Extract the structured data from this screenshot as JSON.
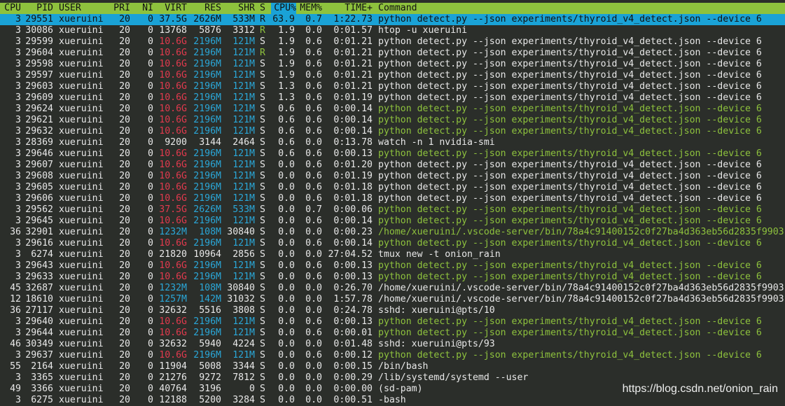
{
  "header": {
    "columns": [
      "CPU",
      "PID",
      "USER",
      "PRI",
      "NI",
      "VIRT",
      "RES",
      "SHR",
      "S",
      "CPU%",
      "MEM%",
      "TIME+",
      "Command"
    ],
    "sorted_column": "CPU%"
  },
  "colors": {
    "header_bg": "#8ec23d",
    "selected_bg": "#1aa2d6",
    "memory_gb": "#e23a4e",
    "memory_mb": "#2aa7d8",
    "thread_cmd": "#8ec23d",
    "running_state": "#8ec23d"
  },
  "processes": [
    {
      "cpu": "3",
      "pid": "29551",
      "user": "xueruini",
      "pri": "20",
      "ni": "0",
      "virt": "37.5G",
      "res": "2626M",
      "shr": "533M",
      "s": "R",
      "cpu_pct": "63.9",
      "mem_pct": "0.7",
      "time": "1:22.73",
      "command": "python detect.py --json experiments/thyroid_v4_detect.json --device 6",
      "selected": true,
      "thread": false
    },
    {
      "cpu": "3",
      "pid": "30086",
      "user": "xueruini",
      "pri": "20",
      "ni": "0",
      "virt": "13768",
      "res": "5876",
      "shr": "3312",
      "s": "R",
      "cpu_pct": "1.9",
      "mem_pct": "0.0",
      "time": "0:01.57",
      "command": "htop -u xueruini",
      "thread": false
    },
    {
      "cpu": "3",
      "pid": "29599",
      "user": "xueruini",
      "pri": "20",
      "ni": "0",
      "virt": "10.6G",
      "res": "2196M",
      "shr": "121M",
      "s": "S",
      "cpu_pct": "1.9",
      "mem_pct": "0.6",
      "time": "0:01.21",
      "command": "python detect.py --json experiments/thyroid_v4_detect.json --device 6",
      "thread": false
    },
    {
      "cpu": "3",
      "pid": "29604",
      "user": "xueruini",
      "pri": "20",
      "ni": "0",
      "virt": "10.6G",
      "res": "2196M",
      "shr": "121M",
      "s": "R",
      "cpu_pct": "1.9",
      "mem_pct": "0.6",
      "time": "0:01.21",
      "command": "python detect.py --json experiments/thyroid_v4_detect.json --device 6",
      "thread": false
    },
    {
      "cpu": "3",
      "pid": "29598",
      "user": "xueruini",
      "pri": "20",
      "ni": "0",
      "virt": "10.6G",
      "res": "2196M",
      "shr": "121M",
      "s": "S",
      "cpu_pct": "1.9",
      "mem_pct": "0.6",
      "time": "0:01.21",
      "command": "python detect.py --json experiments/thyroid_v4_detect.json --device 6",
      "thread": false
    },
    {
      "cpu": "3",
      "pid": "29597",
      "user": "xueruini",
      "pri": "20",
      "ni": "0",
      "virt": "10.6G",
      "res": "2196M",
      "shr": "121M",
      "s": "S",
      "cpu_pct": "1.9",
      "mem_pct": "0.6",
      "time": "0:01.21",
      "command": "python detect.py --json experiments/thyroid_v4_detect.json --device 6",
      "thread": false
    },
    {
      "cpu": "3",
      "pid": "29603",
      "user": "xueruini",
      "pri": "20",
      "ni": "0",
      "virt": "10.6G",
      "res": "2196M",
      "shr": "121M",
      "s": "S",
      "cpu_pct": "1.3",
      "mem_pct": "0.6",
      "time": "0:01.21",
      "command": "python detect.py --json experiments/thyroid_v4_detect.json --device 6",
      "thread": false
    },
    {
      "cpu": "3",
      "pid": "29609",
      "user": "xueruini",
      "pri": "20",
      "ni": "0",
      "virt": "10.6G",
      "res": "2196M",
      "shr": "121M",
      "s": "S",
      "cpu_pct": "1.3",
      "mem_pct": "0.6",
      "time": "0:01.19",
      "command": "python detect.py --json experiments/thyroid_v4_detect.json --device 6",
      "thread": false
    },
    {
      "cpu": "3",
      "pid": "29624",
      "user": "xueruini",
      "pri": "20",
      "ni": "0",
      "virt": "10.6G",
      "res": "2196M",
      "shr": "121M",
      "s": "S",
      "cpu_pct": "0.6",
      "mem_pct": "0.6",
      "time": "0:00.14",
      "command": "python detect.py --json experiments/thyroid_v4_detect.json --device 6",
      "thread": true
    },
    {
      "cpu": "3",
      "pid": "29621",
      "user": "xueruini",
      "pri": "20",
      "ni": "0",
      "virt": "10.6G",
      "res": "2196M",
      "shr": "121M",
      "s": "S",
      "cpu_pct": "0.6",
      "mem_pct": "0.6",
      "time": "0:00.14",
      "command": "python detect.py --json experiments/thyroid_v4_detect.json --device 6",
      "thread": true
    },
    {
      "cpu": "3",
      "pid": "29632",
      "user": "xueruini",
      "pri": "20",
      "ni": "0",
      "virt": "10.6G",
      "res": "2196M",
      "shr": "121M",
      "s": "S",
      "cpu_pct": "0.6",
      "mem_pct": "0.6",
      "time": "0:00.14",
      "command": "python detect.py --json experiments/thyroid_v4_detect.json --device 6",
      "thread": true
    },
    {
      "cpu": "3",
      "pid": "28369",
      "user": "xueruini",
      "pri": "20",
      "ni": "0",
      "virt": "9200",
      "res": "3144",
      "shr": "2464",
      "s": "S",
      "cpu_pct": "0.6",
      "mem_pct": "0.0",
      "time": "0:13.78",
      "command": "watch -n 1 nvidia-smi",
      "thread": false
    },
    {
      "cpu": "3",
      "pid": "29646",
      "user": "xueruini",
      "pri": "20",
      "ni": "0",
      "virt": "10.6G",
      "res": "2196M",
      "shr": "121M",
      "s": "S",
      "cpu_pct": "0.6",
      "mem_pct": "0.6",
      "time": "0:00.13",
      "command": "python detect.py --json experiments/thyroid_v4_detect.json --device 6",
      "thread": true
    },
    {
      "cpu": "3",
      "pid": "29607",
      "user": "xueruini",
      "pri": "20",
      "ni": "0",
      "virt": "10.6G",
      "res": "2196M",
      "shr": "121M",
      "s": "S",
      "cpu_pct": "0.0",
      "mem_pct": "0.6",
      "time": "0:01.20",
      "command": "python detect.py --json experiments/thyroid_v4_detect.json --device 6",
      "thread": false
    },
    {
      "cpu": "3",
      "pid": "29608",
      "user": "xueruini",
      "pri": "20",
      "ni": "0",
      "virt": "10.6G",
      "res": "2196M",
      "shr": "121M",
      "s": "S",
      "cpu_pct": "0.0",
      "mem_pct": "0.6",
      "time": "0:01.19",
      "command": "python detect.py --json experiments/thyroid_v4_detect.json --device 6",
      "thread": false
    },
    {
      "cpu": "3",
      "pid": "29605",
      "user": "xueruini",
      "pri": "20",
      "ni": "0",
      "virt": "10.6G",
      "res": "2196M",
      "shr": "121M",
      "s": "S",
      "cpu_pct": "0.0",
      "mem_pct": "0.6",
      "time": "0:01.18",
      "command": "python detect.py --json experiments/thyroid_v4_detect.json --device 6",
      "thread": false
    },
    {
      "cpu": "3",
      "pid": "29606",
      "user": "xueruini",
      "pri": "20",
      "ni": "0",
      "virt": "10.6G",
      "res": "2196M",
      "shr": "121M",
      "s": "S",
      "cpu_pct": "0.0",
      "mem_pct": "0.6",
      "time": "0:01.18",
      "command": "python detect.py --json experiments/thyroid_v4_detect.json --device 6",
      "thread": false
    },
    {
      "cpu": "3",
      "pid": "29562",
      "user": "xueruini",
      "pri": "20",
      "ni": "0",
      "virt": "37.5G",
      "res": "2626M",
      "shr": "533M",
      "s": "S",
      "cpu_pct": "0.0",
      "mem_pct": "0.7",
      "time": "0:00.06",
      "command": "python detect.py --json experiments/thyroid_v4_detect.json --device 6",
      "thread": true
    },
    {
      "cpu": "3",
      "pid": "29645",
      "user": "xueruini",
      "pri": "20",
      "ni": "0",
      "virt": "10.6G",
      "res": "2196M",
      "shr": "121M",
      "s": "S",
      "cpu_pct": "0.0",
      "mem_pct": "0.6",
      "time": "0:00.14",
      "command": "python detect.py --json experiments/thyroid_v4_detect.json --device 6",
      "thread": true
    },
    {
      "cpu": "36",
      "pid": "32901",
      "user": "xueruini",
      "pri": "20",
      "ni": "0",
      "virt": "1232M",
      "res": "108M",
      "shr": "30840",
      "s": "S",
      "cpu_pct": "0.0",
      "mem_pct": "0.0",
      "time": "0:00.23",
      "command": "/home/xueruini/.vscode-server/bin/78a4c91400152c0f27ba4d363eb56d2835f9903",
      "thread": true
    },
    {
      "cpu": "3",
      "pid": "29616",
      "user": "xueruini",
      "pri": "20",
      "ni": "0",
      "virt": "10.6G",
      "res": "2196M",
      "shr": "121M",
      "s": "S",
      "cpu_pct": "0.0",
      "mem_pct": "0.6",
      "time": "0:00.14",
      "command": "python detect.py --json experiments/thyroid_v4_detect.json --device 6",
      "thread": true
    },
    {
      "cpu": "3",
      "pid": "6274",
      "user": "xueruini",
      "pri": "20",
      "ni": "0",
      "virt": "21820",
      "res": "10964",
      "shr": "2856",
      "s": "S",
      "cpu_pct": "0.0",
      "mem_pct": "0.0",
      "time": "27:04.52",
      "command": "tmux new -t onion_rain",
      "thread": false
    },
    {
      "cpu": "3",
      "pid": "29643",
      "user": "xueruini",
      "pri": "20",
      "ni": "0",
      "virt": "10.6G",
      "res": "2196M",
      "shr": "121M",
      "s": "S",
      "cpu_pct": "0.0",
      "mem_pct": "0.6",
      "time": "0:00.13",
      "command": "python detect.py --json experiments/thyroid_v4_detect.json --device 6",
      "thread": true
    },
    {
      "cpu": "3",
      "pid": "29633",
      "user": "xueruini",
      "pri": "20",
      "ni": "0",
      "virt": "10.6G",
      "res": "2196M",
      "shr": "121M",
      "s": "S",
      "cpu_pct": "0.0",
      "mem_pct": "0.6",
      "time": "0:00.13",
      "command": "python detect.py --json experiments/thyroid_v4_detect.json --device 6",
      "thread": true
    },
    {
      "cpu": "45",
      "pid": "32687",
      "user": "xueruini",
      "pri": "20",
      "ni": "0",
      "virt": "1232M",
      "res": "108M",
      "shr": "30840",
      "s": "S",
      "cpu_pct": "0.0",
      "mem_pct": "0.0",
      "time": "0:26.70",
      "command": "/home/xueruini/.vscode-server/bin/78a4c91400152c0f27ba4d363eb56d2835f9903",
      "thread": false
    },
    {
      "cpu": "12",
      "pid": "18610",
      "user": "xueruini",
      "pri": "20",
      "ni": "0",
      "virt": "1257M",
      "res": "142M",
      "shr": "31032",
      "s": "S",
      "cpu_pct": "0.0",
      "mem_pct": "0.0",
      "time": "1:57.78",
      "command": "/home/xueruini/.vscode-server/bin/78a4c91400152c0f27ba4d363eb56d2835f9903",
      "thread": false
    },
    {
      "cpu": "36",
      "pid": "27117",
      "user": "xueruini",
      "pri": "20",
      "ni": "0",
      "virt": "32632",
      "res": "5516",
      "shr": "3808",
      "s": "S",
      "cpu_pct": "0.0",
      "mem_pct": "0.0",
      "time": "0:24.78",
      "command": "sshd: xueruini@pts/10",
      "thread": false
    },
    {
      "cpu": "3",
      "pid": "29640",
      "user": "xueruini",
      "pri": "20",
      "ni": "0",
      "virt": "10.6G",
      "res": "2196M",
      "shr": "121M",
      "s": "S",
      "cpu_pct": "0.0",
      "mem_pct": "0.6",
      "time": "0:00.13",
      "command": "python detect.py --json experiments/thyroid_v4_detect.json --device 6",
      "thread": true
    },
    {
      "cpu": "3",
      "pid": "29644",
      "user": "xueruini",
      "pri": "20",
      "ni": "0",
      "virt": "10.6G",
      "res": "2196M",
      "shr": "121M",
      "s": "S",
      "cpu_pct": "0.0",
      "mem_pct": "0.6",
      "time": "0:00.01",
      "command": "python detect.py --json experiments/thyroid_v4_detect.json --device 6",
      "thread": true
    },
    {
      "cpu": "46",
      "pid": "30349",
      "user": "xueruini",
      "pri": "20",
      "ni": "0",
      "virt": "32632",
      "res": "5940",
      "shr": "4224",
      "s": "S",
      "cpu_pct": "0.0",
      "mem_pct": "0.0",
      "time": "0:01.48",
      "command": "sshd: xueruini@pts/93",
      "thread": false
    },
    {
      "cpu": "3",
      "pid": "29637",
      "user": "xueruini",
      "pri": "20",
      "ni": "0",
      "virt": "10.6G",
      "res": "2196M",
      "shr": "121M",
      "s": "S",
      "cpu_pct": "0.0",
      "mem_pct": "0.6",
      "time": "0:00.12",
      "command": "python detect.py --json experiments/thyroid_v4_detect.json --device 6",
      "thread": true
    },
    {
      "cpu": "55",
      "pid": "2164",
      "user": "xueruini",
      "pri": "20",
      "ni": "0",
      "virt": "11904",
      "res": "5008",
      "shr": "3344",
      "s": "S",
      "cpu_pct": "0.0",
      "mem_pct": "0.0",
      "time": "0:00.15",
      "command": "/bin/bash",
      "thread": false
    },
    {
      "cpu": "3",
      "pid": "3365",
      "user": "xueruini",
      "pri": "20",
      "ni": "0",
      "virt": "21276",
      "res": "9272",
      "shr": "7812",
      "s": "S",
      "cpu_pct": "0.0",
      "mem_pct": "0.0",
      "time": "0:00.29",
      "command": "/lib/systemd/systemd --user",
      "thread": false
    },
    {
      "cpu": "49",
      "pid": "3366",
      "user": "xueruini",
      "pri": "20",
      "ni": "0",
      "virt": "40764",
      "res": "3196",
      "shr": "0",
      "s": "S",
      "cpu_pct": "0.0",
      "mem_pct": "0.0",
      "time": "0:00.00",
      "command": "(sd-pam)",
      "thread": false
    },
    {
      "cpu": "3",
      "pid": "6275",
      "user": "xueruini",
      "pri": "20",
      "ni": "0",
      "virt": "12188",
      "res": "5200",
      "shr": "3284",
      "s": "S",
      "cpu_pct": "0.0",
      "mem_pct": "0.0",
      "time": "0:00.51",
      "command": "-bash",
      "thread": false
    }
  ],
  "watermark": "https://blog.csdn.net/onion_rain"
}
